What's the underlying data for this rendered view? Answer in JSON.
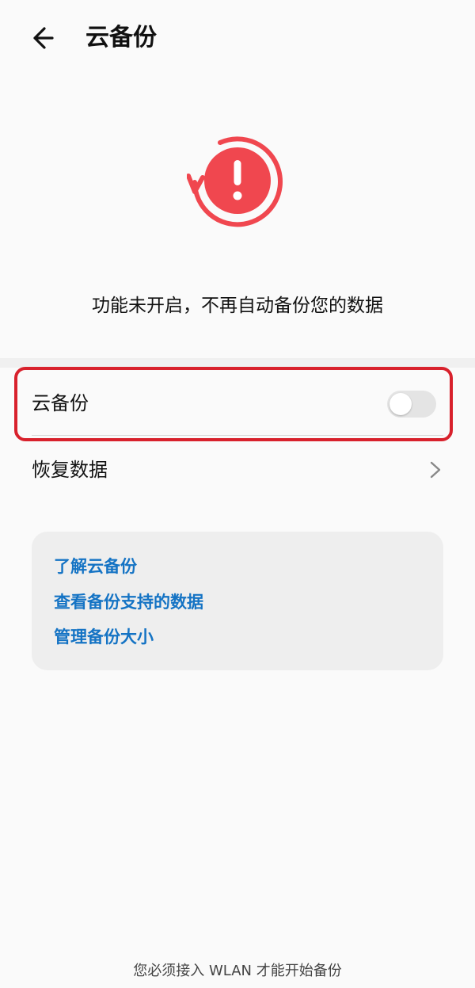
{
  "header": {
    "title": "云备份",
    "back_icon": "arrow-left-icon"
  },
  "status": {
    "icon": "exclamation-sync-icon",
    "icon_color": "#f0474f",
    "message": "功能未开启，不再自动备份您的数据"
  },
  "settings": {
    "backup_label": "云备份",
    "backup_enabled": false,
    "restore_label": "恢复数据",
    "restore_icon": "chevron-right-icon",
    "highlight_color": "#d8212c"
  },
  "info_links": [
    {
      "label": "了解云备份"
    },
    {
      "label": "查看备份支持的数据"
    },
    {
      "label": "管理备份大小"
    }
  ],
  "link_color": "#1473c4",
  "footer": {
    "note": "您必须接入 WLAN 才能开始备份"
  }
}
